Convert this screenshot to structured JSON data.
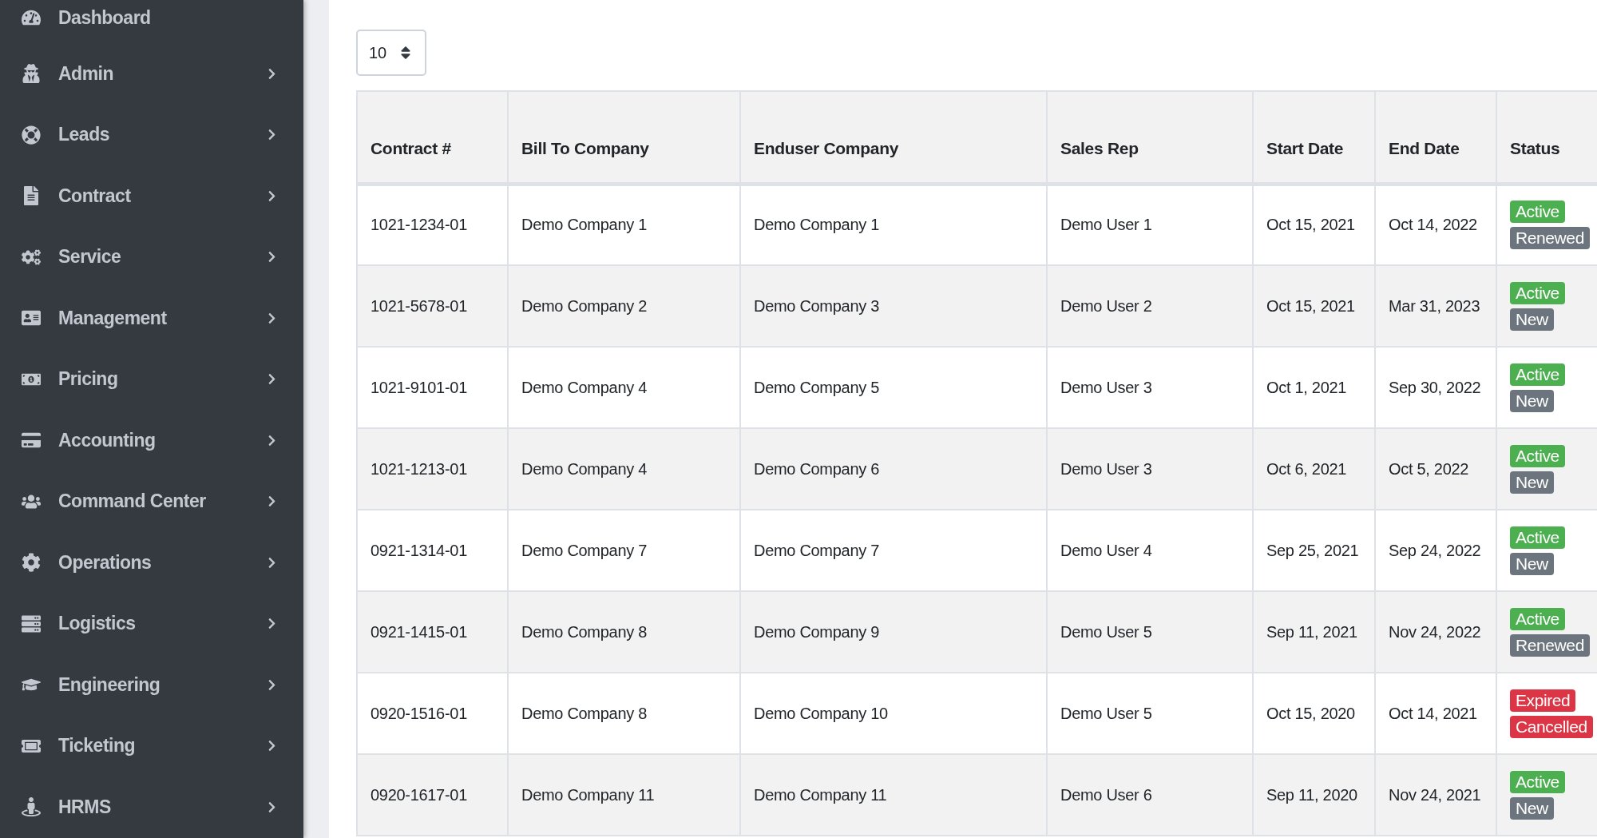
{
  "sidebar": {
    "items": [
      {
        "label": "Dashboard",
        "submenu": false
      },
      {
        "label": "Admin",
        "submenu": true
      },
      {
        "label": "Leads",
        "submenu": true
      },
      {
        "label": "Contract",
        "submenu": true
      },
      {
        "label": "Service",
        "submenu": true
      },
      {
        "label": "Management",
        "submenu": true
      },
      {
        "label": "Pricing",
        "submenu": true
      },
      {
        "label": "Accounting",
        "submenu": true
      },
      {
        "label": "Command Center",
        "submenu": true
      },
      {
        "label": "Operations",
        "submenu": true
      },
      {
        "label": "Logistics",
        "submenu": true
      },
      {
        "label": "Engineering",
        "submenu": true
      },
      {
        "label": "Ticketing",
        "submenu": true
      },
      {
        "label": "HRMS",
        "submenu": true
      }
    ]
  },
  "page_size": {
    "value": "10"
  },
  "table": {
    "columns": [
      "Contract #",
      "Bill To Company",
      "Enduser Company",
      "Sales Rep",
      "Start Date",
      "End Date",
      "Status"
    ],
    "rows": [
      {
        "cells": [
          "1021-1234-01",
          "Demo Company 1",
          "Demo Company 1",
          "Demo User 1",
          "Oct 15, 2021",
          "Oct 14, 2022"
        ],
        "badges": [
          {
            "label": "Active",
            "color": "#4caf50"
          },
          {
            "label": "Renewed",
            "color": "#6c757d"
          }
        ]
      },
      {
        "cells": [
          "1021-5678-01",
          "Demo Company 2",
          "Demo Company 3",
          "Demo User 2",
          "Oct 15, 2021",
          "Mar 31, 2023"
        ],
        "badges": [
          {
            "label": "Active",
            "color": "#4caf50"
          },
          {
            "label": "New",
            "color": "#6c757d"
          }
        ]
      },
      {
        "cells": [
          "1021-9101-01",
          "Demo Company 4",
          "Demo Company 5",
          "Demo User 3",
          "Oct 1, 2021",
          "Sep 30, 2022"
        ],
        "badges": [
          {
            "label": "Active",
            "color": "#4caf50"
          },
          {
            "label": "New",
            "color": "#6c757d"
          }
        ]
      },
      {
        "cells": [
          "1021-1213-01",
          "Demo Company 4",
          "Demo Company 6",
          "Demo User 3",
          "Oct 6, 2021",
          "Oct 5, 2022"
        ],
        "badges": [
          {
            "label": "Active",
            "color": "#4caf50"
          },
          {
            "label": "New",
            "color": "#6c757d"
          }
        ]
      },
      {
        "cells": [
          "0921-1314-01",
          "Demo Company 7",
          "Demo Company 7",
          "Demo User 4",
          "Sep 25, 2021",
          "Sep 24, 2022"
        ],
        "badges": [
          {
            "label": "Active",
            "color": "#4caf50"
          },
          {
            "label": "New",
            "color": "#6c757d"
          }
        ]
      },
      {
        "cells": [
          "0921-1415-01",
          "Demo Company 8",
          "Demo Company 9",
          "Demo User 5",
          "Sep 11, 2021",
          "Nov 24, 2022"
        ],
        "badges": [
          {
            "label": "Active",
            "color": "#4caf50"
          },
          {
            "label": "Renewed",
            "color": "#6c757d"
          }
        ]
      },
      {
        "cells": [
          "0920-1516-01",
          "Demo Company 8",
          "Demo Company 10",
          "Demo User 5",
          "Oct 15, 2020",
          "Oct 14, 2021"
        ],
        "badges": [
          {
            "label": "Expired",
            "color": "#dc3545"
          },
          {
            "label": "Cancelled",
            "color": "#dc3545"
          }
        ]
      },
      {
        "cells": [
          "0920-1617-01",
          "Demo Company 11",
          "Demo Company 11",
          "Demo User 6",
          "Sep 11, 2020",
          "Nov 24, 2021"
        ],
        "badges": [
          {
            "label": "Active",
            "color": "#4caf50"
          },
          {
            "label": "New",
            "color": "#6c757d"
          }
        ]
      }
    ]
  }
}
